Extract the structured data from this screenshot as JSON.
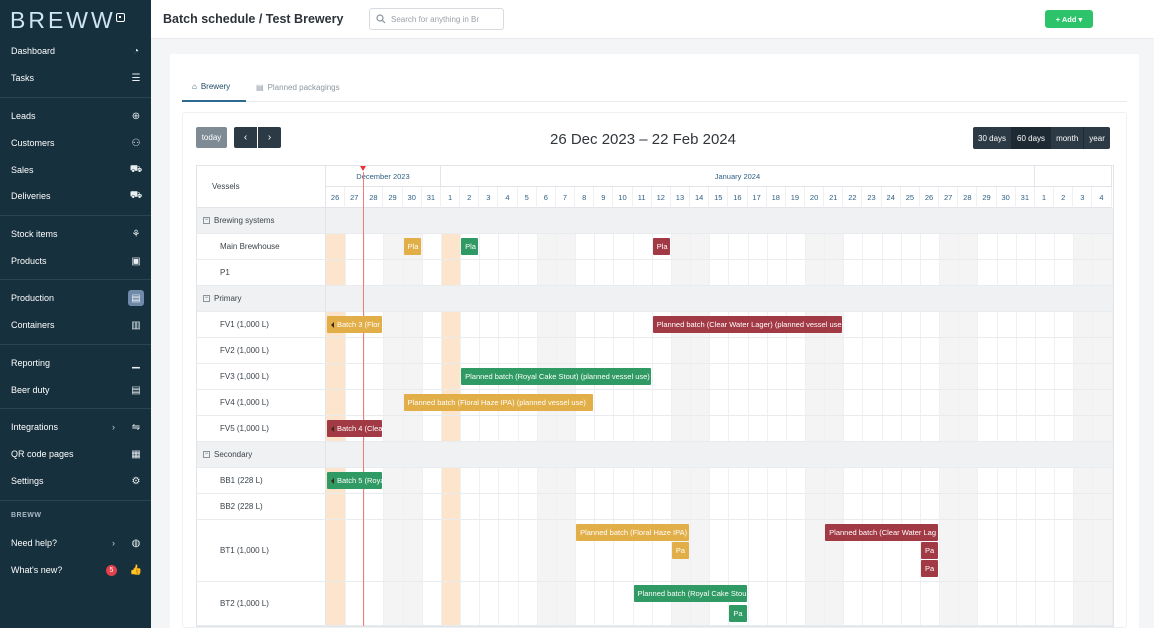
{
  "brand": "BREWW",
  "sidebar": {
    "items": [
      {
        "label": "Dashboard",
        "icon": "gauge-icon",
        "glyph": "◔"
      },
      {
        "label": "Tasks",
        "icon": "tasks-icon",
        "glyph": "☰"
      },
      {
        "label": "Leads",
        "icon": "leads-icon",
        "glyph": "⊕"
      },
      {
        "label": "Customers",
        "icon": "customers-icon",
        "glyph": "⚇"
      },
      {
        "label": "Sales",
        "icon": "cart-icon",
        "glyph": "⛟"
      },
      {
        "label": "Deliveries",
        "icon": "truck-icon",
        "glyph": "⛟"
      },
      {
        "label": "Stock items",
        "icon": "hop-icon",
        "glyph": "⚘"
      },
      {
        "label": "Products",
        "icon": "box-icon",
        "glyph": "▣"
      },
      {
        "label": "Production",
        "icon": "production-icon",
        "glyph": "▤"
      },
      {
        "label": "Containers",
        "icon": "barrel-icon",
        "glyph": "▥"
      },
      {
        "label": "Reporting",
        "icon": "chart-icon",
        "glyph": "▁"
      },
      {
        "label": "Beer duty",
        "icon": "ledger-icon",
        "glyph": "▤"
      },
      {
        "label": "Integrations",
        "icon": "handshake-icon",
        "glyph": "⇋"
      },
      {
        "label": "QR code pages",
        "icon": "qr-icon",
        "glyph": "▦"
      },
      {
        "label": "Settings",
        "icon": "gear-icon",
        "glyph": "⚙"
      }
    ],
    "section_label": "BREWW",
    "help": "Need help?",
    "whats_new": "What's new?",
    "whats_new_badge": "5"
  },
  "header": {
    "title": "Batch schedule / Test Brewery",
    "search_placeholder": "Search for anything in Br",
    "add_label": "+ Add ▾"
  },
  "tabs": [
    {
      "label": "Brewery"
    },
    {
      "label": "Planned packagings"
    }
  ],
  "toolbar": {
    "today": "today",
    "prev": "‹",
    "next": "›",
    "range": "26 Dec 2023 – 22 Feb 2024",
    "views": [
      "30 days",
      "60 days",
      "month",
      "year"
    ]
  },
  "grid": {
    "vessels_header": "Vessels",
    "months": [
      {
        "label": "December 2023"
      },
      {
        "label": "January 2024"
      },
      {
        "label": ""
      }
    ],
    "days": [
      "26",
      "27",
      "28",
      "29",
      "30",
      "31",
      "1",
      "2",
      "3",
      "4",
      "5",
      "6",
      "7",
      "8",
      "9",
      "10",
      "11",
      "12",
      "13",
      "14",
      "15",
      "16",
      "17",
      "18",
      "19",
      "20",
      "21",
      "22",
      "23",
      "24",
      "25",
      "26",
      "27",
      "28",
      "29",
      "30",
      "31",
      "1",
      "2",
      "3",
      "4"
    ],
    "rows": [
      {
        "label": "Brewing systems",
        "group": true
      },
      {
        "label": "Main Brewhouse"
      },
      {
        "label": "P1"
      },
      {
        "label": "Primary",
        "group": true
      },
      {
        "label": "FV1 (1,000 L)"
      },
      {
        "label": "FV2 (1,000 L)"
      },
      {
        "label": "FV3 (1,000 L)"
      },
      {
        "label": "FV4 (1,000 L)"
      },
      {
        "label": "FV5 (1,000 L)"
      },
      {
        "label": "Secondary",
        "group": true
      },
      {
        "label": "BB1 (228 L)"
      },
      {
        "label": "BB2 (228 L)"
      },
      {
        "label": "BT1 (1,000 L)"
      },
      {
        "label": "BT2 (1,000 L)"
      }
    ],
    "events": [
      {
        "label": "Pla",
        "color": "yellow"
      },
      {
        "label": "Pla",
        "color": "green"
      },
      {
        "label": "Pla",
        "color": "red"
      },
      {
        "label": "Batch 3 (Flor",
        "color": "yellow"
      },
      {
        "label": "Planned batch (Clear Water Lager) (planned vessel use",
        "color": "red"
      },
      {
        "label": "Planned batch (Royal Cake Stout) (planned vessel use)",
        "color": "green"
      },
      {
        "label": "Planned batch (Floral Haze IPA) (planned vessel use)",
        "color": "yellow"
      },
      {
        "label": "Batch 4 (Clea",
        "color": "red"
      },
      {
        "label": "Batch 5 (Roya",
        "color": "green"
      },
      {
        "label": "Planned batch (Floral Haze IPA)",
        "color": "yellow"
      },
      {
        "label": "Pa",
        "color": "yellow"
      },
      {
        "label": "Planned batch (Clear Water Lag",
        "color": "red"
      },
      {
        "label": "Pa",
        "color": "red"
      },
      {
        "label": "Pa",
        "color": "red"
      },
      {
        "label": "Planned batch (Royal Cake Stou",
        "color": "green"
      },
      {
        "label": "Pa",
        "color": "green"
      }
    ]
  }
}
